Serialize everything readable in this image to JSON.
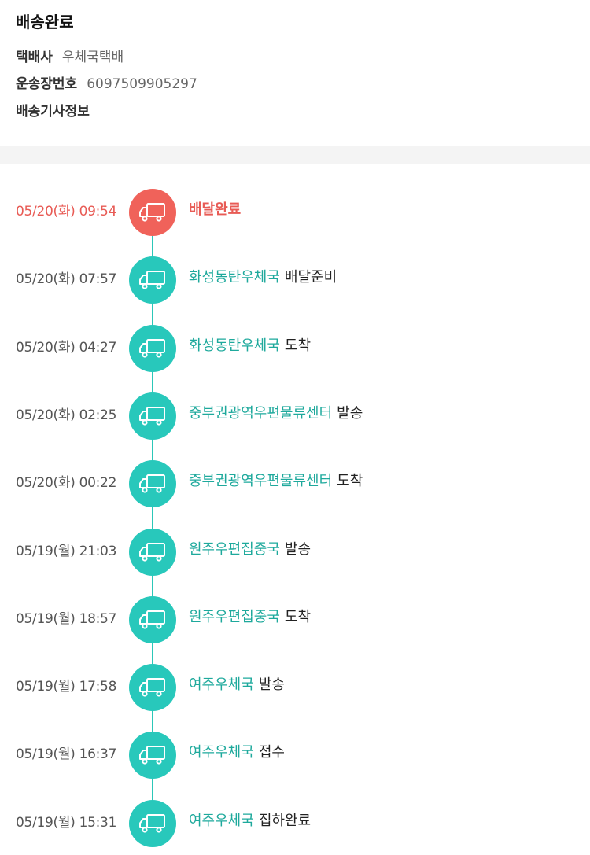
{
  "summary": {
    "status_title": "배송완료",
    "courier_label": "택배사",
    "courier_value": "우체국택배",
    "tracking_label": "운송장번호",
    "tracking_value": "6097509905297",
    "driver_label": "배송기사정보",
    "driver_value": ""
  },
  "colors": {
    "accent_teal": "#28c8bb",
    "current_red": "#f0625a",
    "location_text": "#1ea99c"
  },
  "icon": "delivery-truck-icon",
  "events": [
    {
      "time": "05/20(화) 09:54",
      "location": "",
      "action": "배달완료",
      "current": true
    },
    {
      "time": "05/20(화) 07:57",
      "location": "화성동탄우체국",
      "action": "배달준비"
    },
    {
      "time": "05/20(화) 04:27",
      "location": "화성동탄우체국",
      "action": "도착"
    },
    {
      "time": "05/20(화) 02:25",
      "location": "중부권광역우편물류센터",
      "action": "발송"
    },
    {
      "time": "05/20(화) 00:22",
      "location": "중부권광역우편물류센터",
      "action": "도착"
    },
    {
      "time": "05/19(월) 21:03",
      "location": "원주우편집중국",
      "action": "발송"
    },
    {
      "time": "05/19(월) 18:57",
      "location": "원주우편집중국",
      "action": "도착"
    },
    {
      "time": "05/19(월) 17:58",
      "location": "여주우체국",
      "action": "발송"
    },
    {
      "time": "05/19(월) 16:37",
      "location": "여주우체국",
      "action": "접수"
    },
    {
      "time": "05/19(월) 15:31",
      "location": "여주우체국",
      "action": "집하완료"
    }
  ]
}
